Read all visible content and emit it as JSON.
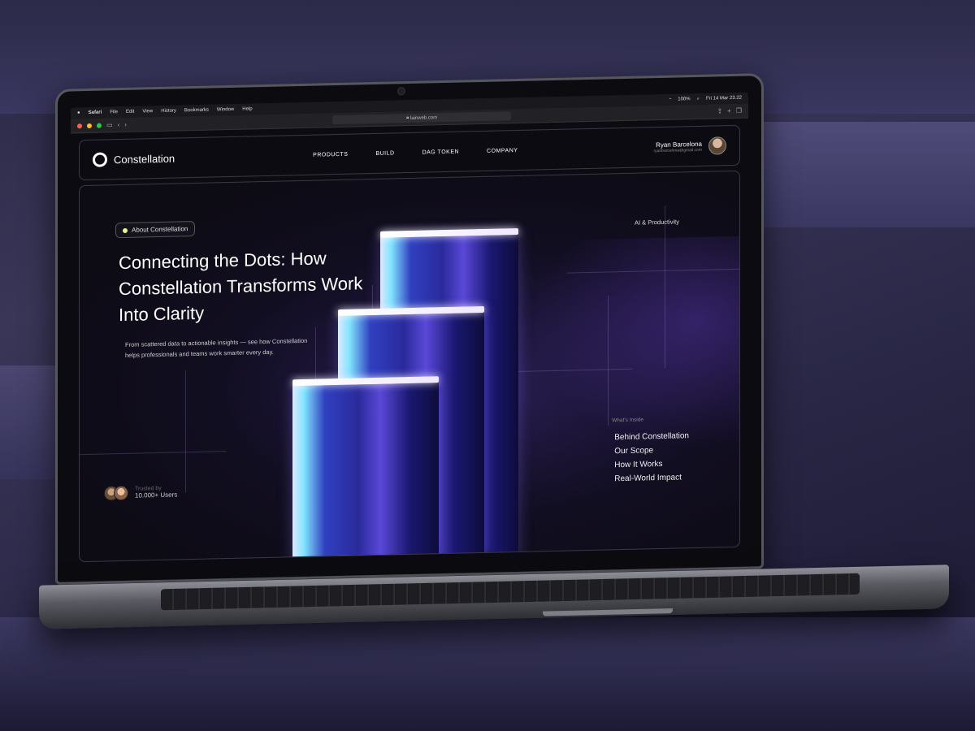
{
  "menubar": {
    "items": [
      "Safari",
      "File",
      "Edit",
      "View",
      "History",
      "Bookmarks",
      "Window",
      "Help"
    ],
    "status": "100%",
    "datetime": "Fri 14 Mar  23.22"
  },
  "browser": {
    "url": "lainweb.com"
  },
  "site": {
    "brand": "Constellation",
    "nav": [
      "PRODUCTS",
      "BUILD",
      "DAG TOKEN",
      "COMPANY"
    ],
    "user": {
      "name": "Ryan Barcelona",
      "email": "ryanbarcelona@gmail.com"
    },
    "hero": {
      "pill": "About Constellation",
      "headline": "Connecting the Dots: How Constellation Transforms Work Into Clarity",
      "subtext": "From scattered data to actionable insights — see how Constellation helps professionals and teams work smarter every day.",
      "category": "AI & Productivity",
      "inside_title": "What's Inside",
      "inside_items": [
        "Behind Constellation",
        "Our Scope",
        "How It Works",
        "Real-World Impact"
      ],
      "trusted_label": "Trusted by",
      "trusted_count": "10.000+ Users"
    }
  },
  "colors": {
    "accent_dot": "#eaf58a",
    "bar_gradient_main": "#2a2a9a",
    "bar_highlight": "#7fe4ff"
  }
}
